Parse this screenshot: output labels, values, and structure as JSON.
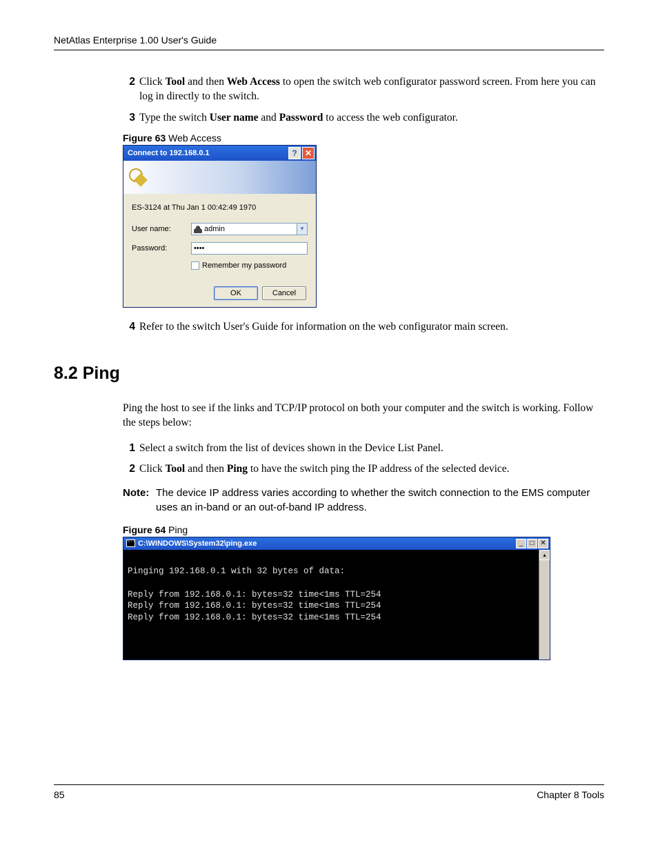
{
  "header": "NetAtlas Enterprise 1.00 User's Guide",
  "step2": {
    "num": "2",
    "pre": "Click ",
    "b1": "Tool",
    "mid1": " and then ",
    "b2": "Web Access",
    "post": " to open the switch web configurator password screen. From here you can log in directly to the switch."
  },
  "step3": {
    "num": "3",
    "pre": "Type the switch ",
    "b1": "User name",
    "mid1": " and ",
    "b2": "Password",
    "post": " to access the web configurator."
  },
  "fig63": {
    "label": "Figure 63",
    "title": "   Web Access"
  },
  "dialog": {
    "title": "Connect to 192.168.0.1",
    "status": "ES-3124 at Thu Jan  1 00:42:49 1970",
    "userLabel": "User name:",
    "userValue": "admin",
    "passLabel": "Password:",
    "passValue": "••••",
    "remember": "Remember my password",
    "ok": "OK",
    "cancel": "Cancel"
  },
  "step4": {
    "num": "4",
    "text": "Refer to the switch User's Guide for information on the web configurator main screen."
  },
  "section": "8.2  Ping",
  "intro": "Ping the host to see if the links and TCP/IP protocol on both your computer and the switch is working. Follow the steps below:",
  "pstep1": {
    "num": "1",
    "text": "Select a switch from the list of devices shown in the Device List Panel."
  },
  "pstep2": {
    "num": "2",
    "pre": "Click ",
    "b1": "Tool",
    "mid1": " and then ",
    "b2": "Ping",
    "post": " to have the switch ping the IP address of the selected device."
  },
  "note": {
    "label": "Note:",
    "body": "The device IP address varies according to whether the switch connection to the EMS computer uses an in-band or an out-of-band IP address."
  },
  "fig64": {
    "label": "Figure 64",
    "title": "   Ping"
  },
  "cmd": {
    "title": "C:\\WINDOWS\\System32\\ping.exe",
    "body": "\nPinging 192.168.0.1 with 32 bytes of data:\n\nReply from 192.168.0.1: bytes=32 time<1ms TTL=254\nReply from 192.168.0.1: bytes=32 time<1ms TTL=254\nReply from 192.168.0.1: bytes=32 time<1ms TTL=254"
  },
  "footer": {
    "page": "85",
    "chapter": "Chapter 8 Tools"
  }
}
